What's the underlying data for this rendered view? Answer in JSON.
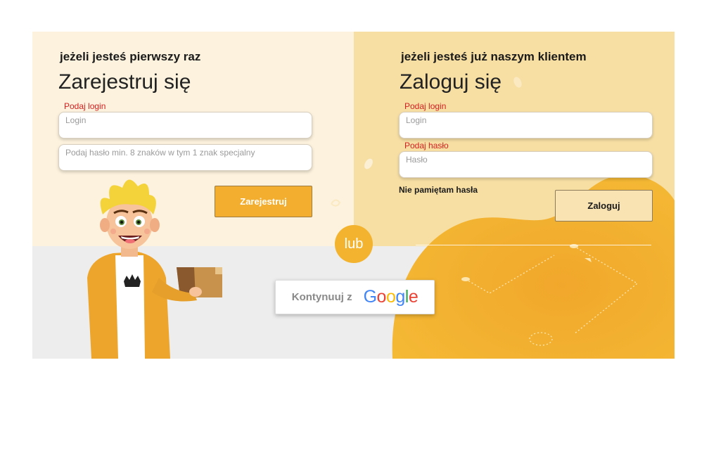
{
  "register": {
    "eyebrow": "jeżeli jesteś pierwszy raz",
    "heading": "Zarejestruj się",
    "login_label": "Podaj login",
    "login_placeholder": "Login",
    "password_placeholder": "Podaj hasło min. 8 znaków w tym 1 znak specjalny",
    "submit_label": "Zarejestruj"
  },
  "login": {
    "eyebrow": "jeżeli jesteś już naszym klientem",
    "heading": "Zaloguj się",
    "login_label": "Podaj login",
    "login_placeholder": "Login",
    "password_label": "Podaj hasło",
    "password_placeholder": "Hasło",
    "forgot_label": "Nie pamiętam hasła",
    "submit_label": "Zaloguj"
  },
  "separator": {
    "label": "lub"
  },
  "google": {
    "label": "Kontynuuj z",
    "logo_text": "Google"
  },
  "colors": {
    "accent": "#f3ae2f",
    "left_panel": "#fcf2dd",
    "right_panel": "#f7dfa4",
    "bottom_band": "#ededed",
    "error_label": "#d42020"
  },
  "icons": [
    "mascot-illustration",
    "decorative-blob",
    "google-logo"
  ]
}
